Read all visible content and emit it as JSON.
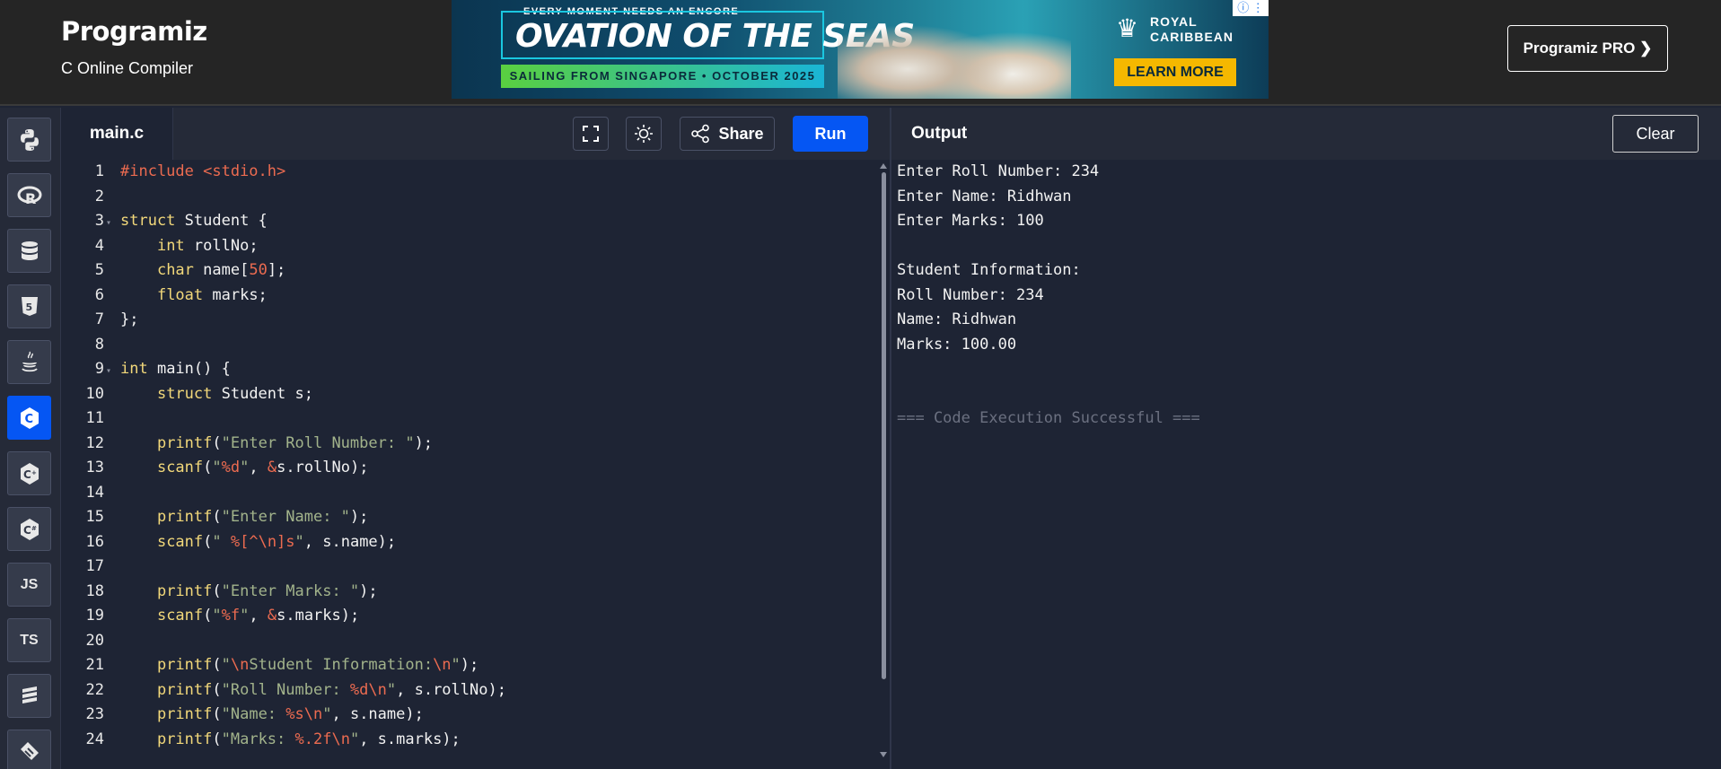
{
  "header": {
    "logo": "Programiz",
    "subtitle": "C Online Compiler",
    "pro_button": "Programiz PRO ❯"
  },
  "ad": {
    "tagline": "EVERY MOMENT NEEDS AN ENCORE",
    "title": "OVATION OF THE SEAS",
    "sailing": "SAILING FROM SINGAPORE • OCTOBER 2025",
    "brand": "ROYAL CARIBBEAN",
    "cta": "LEARN MORE"
  },
  "sidebar": {
    "languages": [
      {
        "name": "python",
        "label": "",
        "active": false
      },
      {
        "name": "r",
        "label": "R",
        "active": false
      },
      {
        "name": "sql",
        "label": "",
        "active": false
      },
      {
        "name": "html",
        "label": "5",
        "active": false
      },
      {
        "name": "java",
        "label": "",
        "active": false
      },
      {
        "name": "c",
        "label": "C",
        "active": true
      },
      {
        "name": "cpp",
        "label": "C",
        "active": false
      },
      {
        "name": "csharp",
        "label": "C",
        "active": false
      },
      {
        "name": "js",
        "label": "JS",
        "active": false
      },
      {
        "name": "ts",
        "label": "TS",
        "active": false
      },
      {
        "name": "swift",
        "label": "",
        "active": false
      },
      {
        "name": "go",
        "label": "",
        "active": false
      }
    ]
  },
  "editor": {
    "filename": "main.c",
    "share_label": "Share",
    "run_label": "Run",
    "lines": [
      "1",
      "2",
      "3",
      "4",
      "5",
      "6",
      "7",
      "8",
      "9",
      "10",
      "11",
      "12",
      "13",
      "14",
      "15",
      "16",
      "17",
      "18",
      "19",
      "20",
      "21",
      "22",
      "23",
      "24"
    ]
  },
  "output": {
    "title": "Output",
    "clear_label": "Clear",
    "lines": [
      "Enter Roll Number: 234",
      "Enter Name: Ridhwan",
      "Enter Marks: 100",
      "",
      "Student Information:",
      "Roll Number: 234",
      "Name: Ridhwan",
      "Marks: 100.00",
      "",
      "",
      "=== Code Execution Successful ==="
    ]
  },
  "colors": {
    "accent": "#0556f3",
    "background": "#1e2434",
    "keyword": "#f2d87a",
    "string": "#a2b38b",
    "number": "#ec6b50"
  }
}
